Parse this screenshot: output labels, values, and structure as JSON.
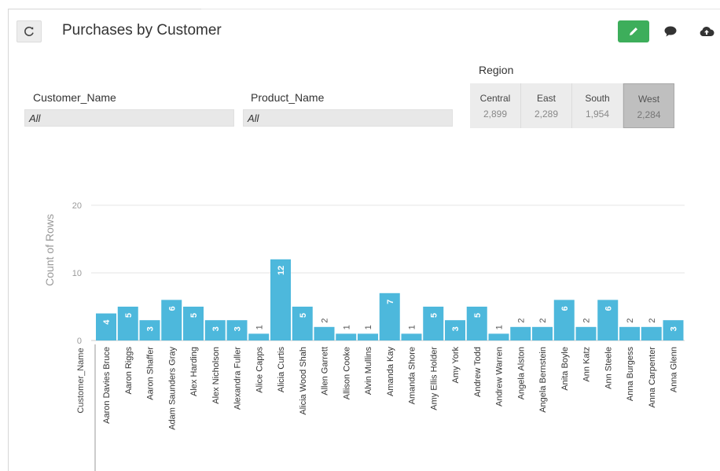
{
  "header": {
    "title": "Purchases by Customer"
  },
  "filters": [
    {
      "label": "Customer_Name",
      "value": "All"
    },
    {
      "label": "Product_Name",
      "value": "All"
    }
  ],
  "region": {
    "title": "Region",
    "tiles": [
      {
        "name": "Central",
        "value": "2,899",
        "selected": false
      },
      {
        "name": "East",
        "value": "2,289",
        "selected": false
      },
      {
        "name": "South",
        "value": "1,954",
        "selected": false
      },
      {
        "name": "West",
        "value": "2,284",
        "selected": true
      }
    ]
  },
  "colors": {
    "bar": "#4db8dc",
    "accent_green": "#3dae5b",
    "label_white": "#ffffff",
    "label_dark": "#555555"
  },
  "chart_data": {
    "type": "bar",
    "categories": [
      "Aaron Davies Bruce",
      "Aaron Riggs",
      "Aaron Shaffer",
      "Adam Saunders Gray",
      "Alex Harding",
      "Alex Nicholson",
      "Alexandra Fuller",
      "Alice Capps",
      "Alicia Curtis",
      "Alicia Wood Shah",
      "Allen Garrett",
      "Allison Cooke",
      "Alvin Mullins",
      "Amanda Kay",
      "Amanda Shore",
      "Amy Ellis Holder",
      "Amy York",
      "Andrew Todd",
      "Andrew Warren",
      "Angela Alston",
      "Angela Bernstein",
      "Anita Boyle",
      "Ann Katz",
      "Ann Steele",
      "Anna Burgess",
      "Anna Carpenter",
      "Anna Glenn"
    ],
    "values": [
      4,
      5,
      3,
      6,
      5,
      3,
      3,
      1,
      12,
      5,
      2,
      1,
      1,
      7,
      1,
      5,
      3,
      5,
      1,
      2,
      2,
      6,
      2,
      6,
      2,
      2,
      3
    ],
    "xlabel": "Customer_Name",
    "ylabel": "Count of Rows",
    "ylim": [
      0,
      20
    ],
    "yticks": [
      0,
      10,
      20
    ],
    "grid": true
  }
}
